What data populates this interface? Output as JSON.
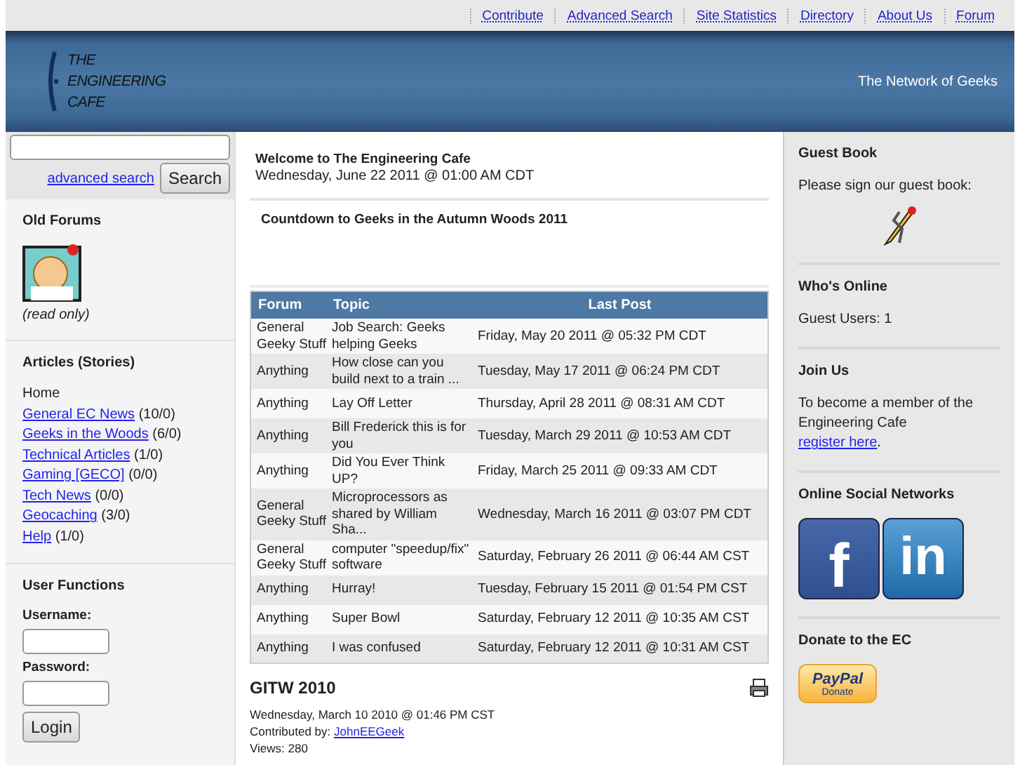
{
  "top_links": [
    "Contribute",
    "Advanced Search",
    "Site Statistics",
    "Directory",
    "About Us",
    "Forum"
  ],
  "header": {
    "logo_lines": [
      "THE",
      "ENGINEERING",
      "CAFE"
    ],
    "tagline": "The Network of Geeks"
  },
  "left": {
    "search": {
      "advanced_link": "advanced search",
      "button": "Search"
    },
    "old_forums": {
      "title": "Old Forums",
      "note": "(read only)"
    },
    "articles": {
      "title": "Articles (Stories)",
      "items": [
        {
          "label": "Home",
          "link": false
        },
        {
          "label": "General EC News",
          "count": "(10/0)",
          "link": true
        },
        {
          "label": "Geeks in the Woods",
          "count": "(6/0)",
          "link": true
        },
        {
          "label": "Technical Articles",
          "count": "(1/0)",
          "link": true
        },
        {
          "label": "Gaming [GECO]",
          "count": "(0/0)",
          "link": true
        },
        {
          "label": "Tech News",
          "count": "(0/0)",
          "link": true
        },
        {
          "label": "Geocaching",
          "count": "(3/0)",
          "link": true
        },
        {
          "label": "Help",
          "count": "(1/0)",
          "link": true
        }
      ]
    },
    "user_functions": {
      "title": "User Functions",
      "username_label": "Username:",
      "password_label": "Password:",
      "button": "Login"
    }
  },
  "center": {
    "welcome_title": "Welcome to The Engineering Cafe",
    "welcome_date": "Wednesday, June 22 2011 @ 01:00 AM CDT",
    "countdown": "Countdown to Geeks in the Autumn Woods 2011",
    "table": {
      "columns": [
        "Forum",
        "Topic",
        "Last Post"
      ],
      "rows": [
        [
          "General Geeky Stuff",
          "Job Search: Geeks helping Geeks",
          "Friday, May 20 2011 @ 05:32 PM CDT"
        ],
        [
          "Anything",
          "How close can you build next to a train ...",
          "Tuesday, May 17 2011 @ 06:24 PM CDT"
        ],
        [
          "Anything",
          "Lay Off Letter",
          "Thursday, April 28 2011 @ 08:31 AM CDT"
        ],
        [
          "Anything",
          "Bill Frederick this is for you",
          "Tuesday, March 29 2011 @ 10:53 AM CDT"
        ],
        [
          "Anything",
          "Did You Ever Think UP?",
          "Friday, March 25 2011 @ 09:33 AM CDT"
        ],
        [
          "General Geeky Stuff",
          "Microprocessors as shared by William Sha...",
          "Wednesday, March 16 2011 @ 03:07 PM CDT"
        ],
        [
          "General Geeky Stuff",
          "computer \"speedup/fix\" software",
          "Saturday, February 26 2011 @ 06:44 AM CST"
        ],
        [
          "Anything",
          "Hurray!",
          "Tuesday, February 15 2011 @ 01:54 PM CST"
        ],
        [
          "Anything",
          "Super Bowl",
          "Saturday, February 12 2011 @ 10:35 AM CST"
        ],
        [
          "Anything",
          "I was confused",
          "Saturday, February 12 2011 @ 10:31 AM CST"
        ]
      ]
    },
    "story": {
      "title": "GITW 2010",
      "date": "Wednesday, March 10 2010 @ 01:46 PM CST",
      "contributed_label": "Contributed by:",
      "author": "JohnEEGeek",
      "views": "Views: 280"
    }
  },
  "right": {
    "guest_book": {
      "title": "Guest Book",
      "text": "Please sign our guest book:"
    },
    "whos_online": {
      "title": "Who's Online",
      "text": "Guest Users: 1"
    },
    "join": {
      "title": "Join Us",
      "text": "To become a member of the Engineering Cafe",
      "link": "register here",
      "after": "."
    },
    "social": {
      "title": "Online Social Networks",
      "items": [
        "f",
        "in"
      ]
    },
    "donate": {
      "title": "Donate to the EC",
      "brand": "PayPal",
      "button": "Donate"
    }
  }
}
